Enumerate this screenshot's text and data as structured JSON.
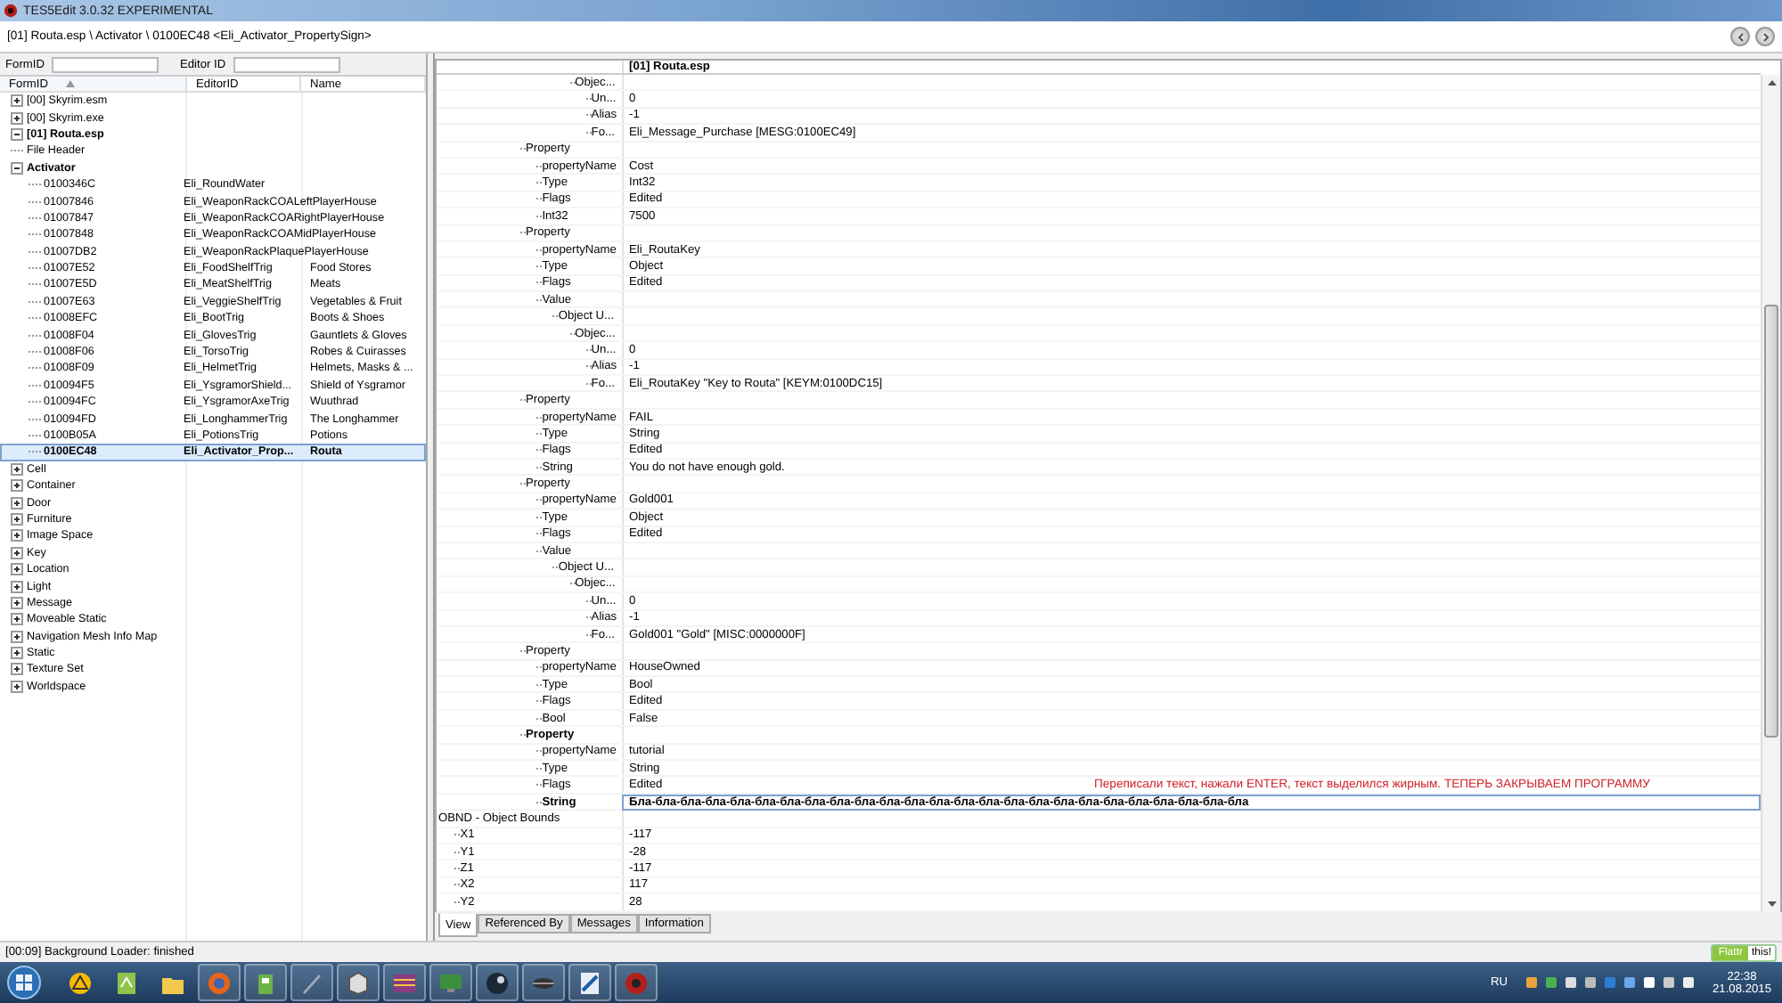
{
  "window": {
    "title": "TES5Edit 3.0.32 EXPERIMENTAL"
  },
  "path": "[01] Routa.esp \\ Activator \\ 0100EC48 <Eli_Activator_PropertySign>",
  "filter": {
    "fields": [
      {
        "label": "FormID"
      },
      {
        "label": "Editor ID"
      }
    ]
  },
  "tree": {
    "columns": [
      {
        "label": "FormID",
        "sorted": true
      },
      {
        "label": "EditorID",
        "sorted": false
      },
      {
        "label": "Name",
        "sorted": false
      }
    ],
    "rows": [
      {
        "form_id": "[00] Skyrim.esm",
        "expanded": false
      },
      {
        "form_id": "[00] Skyrim.exe",
        "expanded": false
      },
      {
        "form_id": "[01] Routa.esp",
        "bold": true,
        "expanded": true,
        "children": [
          {
            "form_id": "File Header"
          },
          {
            "form_id": "Activator",
            "bold": true,
            "expanded": true,
            "children": [
              {
                "form_id": "0100346C",
                "editor_id": "Eli_RoundWater",
                "selected": false
              },
              {
                "form_id": "01007846",
                "editor_id": "Eli_WeaponRackCOALeftPlayerHouse",
                "selected": false
              },
              {
                "form_id": "01007847",
                "editor_id": "Eli_WeaponRackCOARightPlayerHouse",
                "selected": false
              },
              {
                "form_id": "01007848",
                "editor_id": "Eli_WeaponRackCOAMidPlayerHouse",
                "selected": false
              },
              {
                "form_id": "01007DB2",
                "editor_id": "Eli_WeaponRackPlaquePlayerHouse",
                "selected": false
              },
              {
                "form_id": "01007E52",
                "editor_id": "Eli_FoodShelfTrig",
                "name": "Food Stores",
                "selected": false
              },
              {
                "form_id": "01007E5D",
                "editor_id": "Eli_MeatShelfTrig",
                "name": "Meats",
                "selected": false
              },
              {
                "form_id": "01007E63",
                "editor_id": "Eli_VeggieShelfTrig",
                "name": "Vegetables & Fruit",
                "selected": false
              },
              {
                "form_id": "01008EFC",
                "editor_id": "Eli_BootTrig",
                "name": "Boots & Shoes",
                "selected": false
              },
              {
                "form_id": "01008F04",
                "editor_id": "Eli_GlovesTrig",
                "name": "Gauntlets & Gloves",
                "selected": false
              },
              {
                "form_id": "01008F06",
                "editor_id": "Eli_TorsoTrig",
                "name": "Robes & Cuirasses",
                "selected": false
              },
              {
                "form_id": "01008F09",
                "editor_id": "Eli_HelmetTrig",
                "name": "Helmets, Masks & ...",
                "selected": false
              },
              {
                "form_id": "010094F5",
                "editor_id": "Eli_YsgramorShield...",
                "name": "Shield of Ysgramor",
                "selected": false
              },
              {
                "form_id": "010094FC",
                "editor_id": "Eli_YsgramorAxeTrig",
                "name": "Wuuthrad",
                "selected": false
              },
              {
                "form_id": "010094FD",
                "editor_id": "Eli_LonghammerTrig",
                "name": "The Longhammer",
                "selected": false
              },
              {
                "form_id": "0100B05A",
                "editor_id": "Eli_PotionsTrig",
                "name": "Potions",
                "selected": false
              },
              {
                "form_id": "0100EC48",
                "editor_id": "Eli_Activator_Prop...",
                "name": "Routa",
                "bold": true,
                "selected": true
              }
            ]
          },
          {
            "form_id": "Cell",
            "expanded": false
          },
          {
            "form_id": "Container",
            "expanded": false
          },
          {
            "form_id": "Door",
            "expanded": false
          },
          {
            "form_id": "Furniture",
            "expanded": false
          },
          {
            "form_id": "Image Space",
            "expanded": false
          },
          {
            "form_id": "Key",
            "expanded": false
          },
          {
            "form_id": "Location",
            "expanded": false
          },
          {
            "form_id": "Light",
            "expanded": false
          },
          {
            "form_id": "Message",
            "expanded": false
          },
          {
            "form_id": "Moveable Static",
            "expanded": false
          },
          {
            "form_id": "Navigation Mesh Info Map",
            "expanded": false
          },
          {
            "form_id": "Static",
            "expanded": false
          },
          {
            "form_id": "Texture Set",
            "expanded": false
          },
          {
            "form_id": "Worldspace",
            "expanded": false
          }
        ]
      }
    ]
  },
  "view": {
    "header": "[01] Routa.esp",
    "rows": [
      {
        "kind": "object",
        "label": "Objec...",
        "children": [
          {
            "label": "Un...",
            "value": "0"
          },
          {
            "label": "Alias",
            "value": "-1"
          },
          {
            "label": "Fo...",
            "value": "Eli_Message_Purchase [MESG:0100EC49]"
          }
        ]
      },
      {
        "kind": "property",
        "label": "Property",
        "children": [
          {
            "label": "propertyName",
            "value": "Cost"
          },
          {
            "label": "Type",
            "value": "Int32"
          },
          {
            "label": "Flags",
            "value": "Edited"
          },
          {
            "label": "Int32",
            "value": "7500"
          }
        ]
      },
      {
        "kind": "property",
        "label": "Property",
        "children": [
          {
            "label": "propertyName",
            "value": "Eli_RoutaKey"
          },
          {
            "label": "Type",
            "value": "Object"
          },
          {
            "label": "Flags",
            "value": "Edited"
          },
          {
            "label": "Value",
            "children": [
              {
                "label": "Object U...",
                "children": [
                  {
                    "label": "Objec...",
                    "children": [
                      {
                        "label": "Un...",
                        "value": "0"
                      },
                      {
                        "label": "Alias",
                        "value": "-1"
                      },
                      {
                        "label": "Fo...",
                        "value": "Eli_RoutaKey \"Key to Routa\" [KEYM:0100DC15]"
                      }
                    ]
                  }
                ]
              }
            ]
          }
        ]
      },
      {
        "kind": "property",
        "label": "Property",
        "children": [
          {
            "label": "propertyName",
            "value": "FAIL"
          },
          {
            "label": "Type",
            "value": "String"
          },
          {
            "label": "Flags",
            "value": "Edited"
          },
          {
            "label": "String",
            "value": "You do not have enough gold."
          }
        ]
      },
      {
        "kind": "property",
        "label": "Property",
        "children": [
          {
            "label": "propertyName",
            "value": "Gold001"
          },
          {
            "label": "Type",
            "value": "Object"
          },
          {
            "label": "Flags",
            "value": "Edited"
          },
          {
            "label": "Value",
            "children": [
              {
                "label": "Object U...",
                "children": [
                  {
                    "label": "Objec...",
                    "children": [
                      {
                        "label": "Un...",
                        "value": "0"
                      },
                      {
                        "label": "Alias",
                        "value": "-1"
                      },
                      {
                        "label": "Fo...",
                        "value": "Gold001 \"Gold\" [MISC:0000000F]"
                      }
                    ]
                  }
                ]
              }
            ]
          }
        ]
      },
      {
        "kind": "property",
        "label": "Property",
        "children": [
          {
            "label": "propertyName",
            "value": "HouseOwned"
          },
          {
            "label": "Type",
            "value": "Bool"
          },
          {
            "label": "Flags",
            "value": "Edited"
          },
          {
            "label": "Bool",
            "value": "False"
          }
        ]
      },
      {
        "kind": "property",
        "label": "Property",
        "bold": true,
        "children": [
          {
            "label": "propertyName",
            "value": "tutorial"
          },
          {
            "label": "Type",
            "value": "String"
          },
          {
            "label": "Flags",
            "value": "Edited",
            "note": "Переписали текст,  нажали ENTER, текст выделился жирным. ТЕПЕРЬ ЗАКРЫВАЕМ ПРОГРАММУ"
          },
          {
            "label": "String",
            "value": "Бла-бла-бла-бла-бла-бла-бла-бла-бла-бла-бла-бла-бла-бла-бла-бла-бла-бла-бла-бла-бла-бла-бла-бла-бла",
            "bold": true,
            "editing": true
          }
        ]
      },
      {
        "kind": "record",
        "label": "OBND - Object Bounds",
        "children": [
          {
            "label": "X1",
            "value": "-117"
          },
          {
            "label": "Y1",
            "value": "-28"
          },
          {
            "label": "Z1",
            "value": "-117"
          },
          {
            "label": "X2",
            "value": "117"
          },
          {
            "label": "Y2",
            "value": "28"
          }
        ]
      }
    ]
  },
  "tabs": [
    {
      "label": "View",
      "selected": true
    },
    {
      "label": "Referenced By",
      "selected": false
    },
    {
      "label": "Messages",
      "selected": false
    },
    {
      "label": "Information",
      "selected": false
    }
  ],
  "status_bar": {
    "text": "[00:09] Background Loader: finished",
    "flattr": "Flattr",
    "flattr_suffix": "this!"
  },
  "taskbar": {
    "language": "RU",
    "time": "22:38",
    "date": "21.08.2015"
  }
}
